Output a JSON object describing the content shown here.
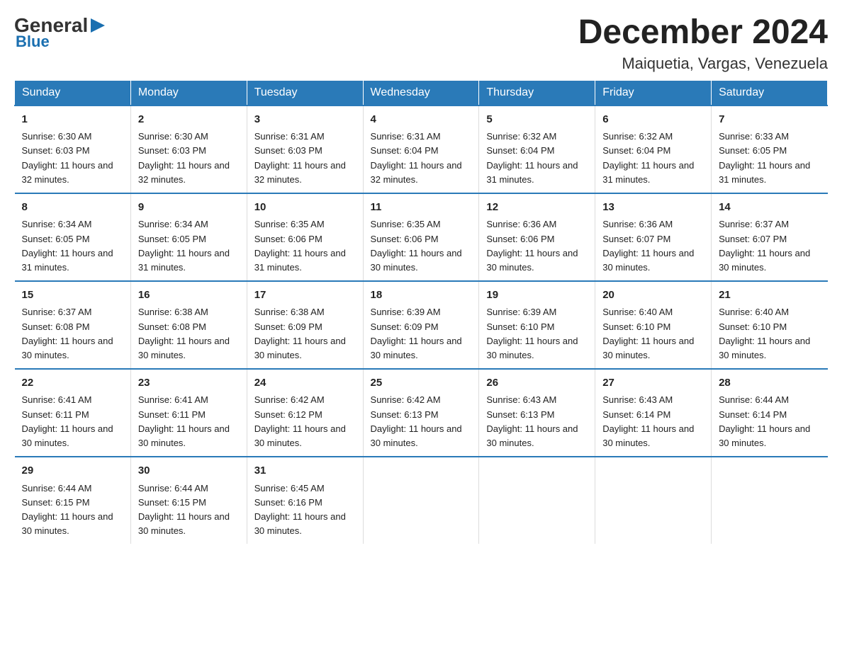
{
  "logo": {
    "general": "General",
    "blue": "Blue",
    "arrow_color": "#1a6fb0"
  },
  "title": "December 2024",
  "subtitle": "Maiquetia, Vargas, Venezuela",
  "days_of_week": [
    "Sunday",
    "Monday",
    "Tuesday",
    "Wednesday",
    "Thursday",
    "Friday",
    "Saturday"
  ],
  "weeks": [
    [
      {
        "day": "1",
        "sunrise": "6:30 AM",
        "sunset": "6:03 PM",
        "daylight": "11 hours and 32 minutes."
      },
      {
        "day": "2",
        "sunrise": "6:30 AM",
        "sunset": "6:03 PM",
        "daylight": "11 hours and 32 minutes."
      },
      {
        "day": "3",
        "sunrise": "6:31 AM",
        "sunset": "6:03 PM",
        "daylight": "11 hours and 32 minutes."
      },
      {
        "day": "4",
        "sunrise": "6:31 AM",
        "sunset": "6:04 PM",
        "daylight": "11 hours and 32 minutes."
      },
      {
        "day": "5",
        "sunrise": "6:32 AM",
        "sunset": "6:04 PM",
        "daylight": "11 hours and 31 minutes."
      },
      {
        "day": "6",
        "sunrise": "6:32 AM",
        "sunset": "6:04 PM",
        "daylight": "11 hours and 31 minutes."
      },
      {
        "day": "7",
        "sunrise": "6:33 AM",
        "sunset": "6:05 PM",
        "daylight": "11 hours and 31 minutes."
      }
    ],
    [
      {
        "day": "8",
        "sunrise": "6:34 AM",
        "sunset": "6:05 PM",
        "daylight": "11 hours and 31 minutes."
      },
      {
        "day": "9",
        "sunrise": "6:34 AM",
        "sunset": "6:05 PM",
        "daylight": "11 hours and 31 minutes."
      },
      {
        "day": "10",
        "sunrise": "6:35 AM",
        "sunset": "6:06 PM",
        "daylight": "11 hours and 31 minutes."
      },
      {
        "day": "11",
        "sunrise": "6:35 AM",
        "sunset": "6:06 PM",
        "daylight": "11 hours and 30 minutes."
      },
      {
        "day": "12",
        "sunrise": "6:36 AM",
        "sunset": "6:06 PM",
        "daylight": "11 hours and 30 minutes."
      },
      {
        "day": "13",
        "sunrise": "6:36 AM",
        "sunset": "6:07 PM",
        "daylight": "11 hours and 30 minutes."
      },
      {
        "day": "14",
        "sunrise": "6:37 AM",
        "sunset": "6:07 PM",
        "daylight": "11 hours and 30 minutes."
      }
    ],
    [
      {
        "day": "15",
        "sunrise": "6:37 AM",
        "sunset": "6:08 PM",
        "daylight": "11 hours and 30 minutes."
      },
      {
        "day": "16",
        "sunrise": "6:38 AM",
        "sunset": "6:08 PM",
        "daylight": "11 hours and 30 minutes."
      },
      {
        "day": "17",
        "sunrise": "6:38 AM",
        "sunset": "6:09 PM",
        "daylight": "11 hours and 30 minutes."
      },
      {
        "day": "18",
        "sunrise": "6:39 AM",
        "sunset": "6:09 PM",
        "daylight": "11 hours and 30 minutes."
      },
      {
        "day": "19",
        "sunrise": "6:39 AM",
        "sunset": "6:10 PM",
        "daylight": "11 hours and 30 minutes."
      },
      {
        "day": "20",
        "sunrise": "6:40 AM",
        "sunset": "6:10 PM",
        "daylight": "11 hours and 30 minutes."
      },
      {
        "day": "21",
        "sunrise": "6:40 AM",
        "sunset": "6:10 PM",
        "daylight": "11 hours and 30 minutes."
      }
    ],
    [
      {
        "day": "22",
        "sunrise": "6:41 AM",
        "sunset": "6:11 PM",
        "daylight": "11 hours and 30 minutes."
      },
      {
        "day": "23",
        "sunrise": "6:41 AM",
        "sunset": "6:11 PM",
        "daylight": "11 hours and 30 minutes."
      },
      {
        "day": "24",
        "sunrise": "6:42 AM",
        "sunset": "6:12 PM",
        "daylight": "11 hours and 30 minutes."
      },
      {
        "day": "25",
        "sunrise": "6:42 AM",
        "sunset": "6:13 PM",
        "daylight": "11 hours and 30 minutes."
      },
      {
        "day": "26",
        "sunrise": "6:43 AM",
        "sunset": "6:13 PM",
        "daylight": "11 hours and 30 minutes."
      },
      {
        "day": "27",
        "sunrise": "6:43 AM",
        "sunset": "6:14 PM",
        "daylight": "11 hours and 30 minutes."
      },
      {
        "day": "28",
        "sunrise": "6:44 AM",
        "sunset": "6:14 PM",
        "daylight": "11 hours and 30 minutes."
      }
    ],
    [
      {
        "day": "29",
        "sunrise": "6:44 AM",
        "sunset": "6:15 PM",
        "daylight": "11 hours and 30 minutes."
      },
      {
        "day": "30",
        "sunrise": "6:44 AM",
        "sunset": "6:15 PM",
        "daylight": "11 hours and 30 minutes."
      },
      {
        "day": "31",
        "sunrise": "6:45 AM",
        "sunset": "6:16 PM",
        "daylight": "11 hours and 30 minutes."
      },
      null,
      null,
      null,
      null
    ]
  ]
}
